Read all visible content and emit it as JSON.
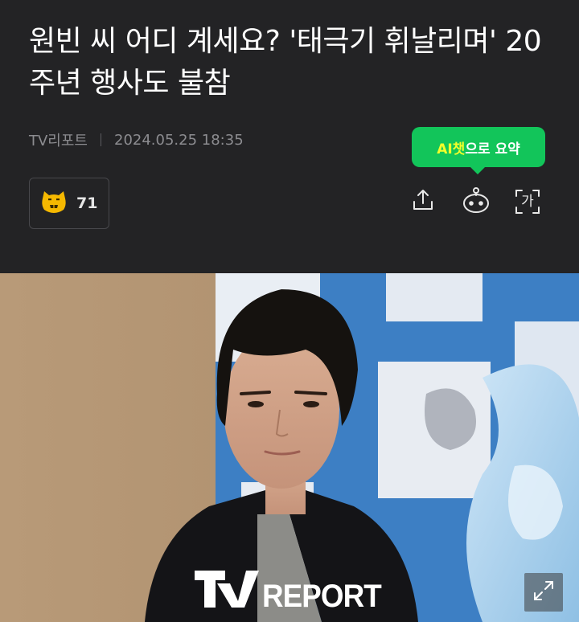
{
  "article": {
    "title": "원빈 씨 어디 계세요? '태극기 휘날리며' 20주년 행사도 불참",
    "source": "TV리포트",
    "datetime": "2024.05.25 18:35"
  },
  "ai_summary": {
    "strong": "AI챗",
    "rest": "으로 요약"
  },
  "reaction": {
    "icon": "cat-face-icon",
    "count": "71"
  },
  "toolbar": {
    "share_icon": "share-icon",
    "chatbot_icon": "chatbot-icon",
    "font_size_icon": "font-size-icon",
    "font_size_label": "가"
  },
  "photo": {
    "watermark_text": "REPORT",
    "watermark_logo_letter": "TV",
    "expand_icon": "expand-icon"
  },
  "colors": {
    "background": "#232325",
    "accent_green": "#12c55a",
    "accent_yellow": "#f2ff2a",
    "meta_gray": "#8c8c90"
  }
}
